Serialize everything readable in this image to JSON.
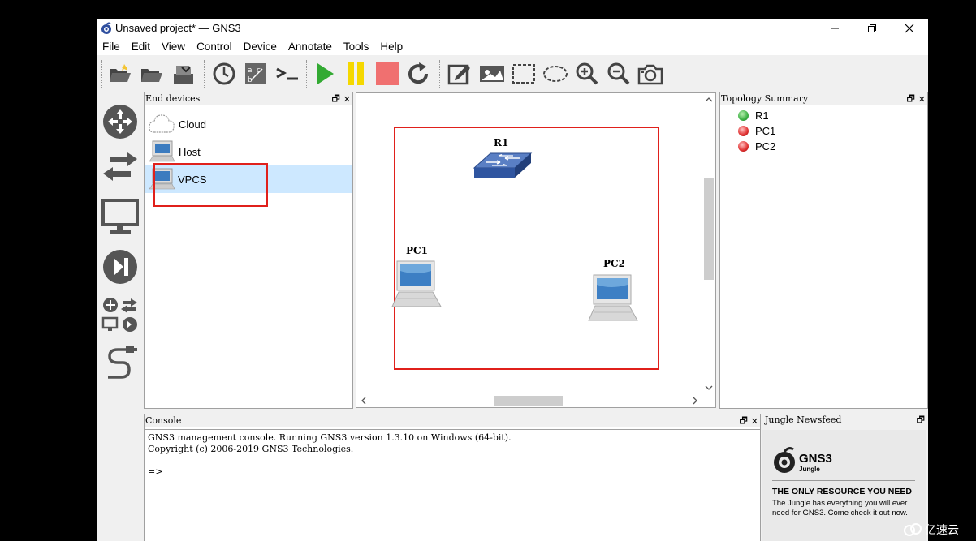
{
  "window": {
    "title": "Unsaved project* — GNS3",
    "controls": [
      "minimize",
      "restore",
      "close"
    ]
  },
  "menu": [
    "File",
    "Edit",
    "View",
    "Control",
    "Device",
    "Annotate",
    "Tools",
    "Help"
  ],
  "toolbar": {
    "buttons": [
      "new-project",
      "open-project",
      "save-project",
      "snapshot",
      "show-interface-labels",
      "console-all",
      "start-all",
      "suspend-all",
      "stop-all",
      "reload-all",
      "add-note",
      "insert-image",
      "draw-rectangle",
      "draw-ellipse",
      "zoom-in",
      "zoom-out",
      "screenshot"
    ]
  },
  "left_toolbar": [
    "routers",
    "switches",
    "end-devices",
    "security-devices",
    "all-devices",
    "add-link"
  ],
  "end_devices": {
    "title": "End devices",
    "items": [
      {
        "label": "Cloud"
      },
      {
        "label": "Host"
      },
      {
        "label": "VPCS"
      }
    ]
  },
  "topology": {
    "nodes": [
      {
        "label": "R1"
      },
      {
        "label": "PC1"
      },
      {
        "label": "PC2"
      }
    ]
  },
  "topology_summary": {
    "title": "Topology Summary",
    "items": [
      {
        "label": "R1",
        "status_color": "#3cb043"
      },
      {
        "label": "PC1",
        "status_color": "#e03030"
      },
      {
        "label": "PC2",
        "status_color": "#e03030"
      }
    ]
  },
  "console": {
    "title": "Console",
    "line1": "GNS3 management console. Running GNS3 version 1.3.10 on Windows (64-bit).",
    "line2": "Copyright (c) 2006-2019 GNS3 Technologies.",
    "prompt": "=>"
  },
  "newsfeed": {
    "title": "Jungle Newsfeed",
    "logo_text": "GNS3",
    "logo_sub": "Jungle",
    "headline": "THE ONLY RESOURCE YOU NEED",
    "body": "The Jungle has everything you will ever need for GNS3. Come check it out now."
  },
  "watermark": "亿速云",
  "colors": {
    "selection": "#cde8ff",
    "highlight_box": "#e0201b",
    "play": "#33aa33",
    "pause": "#f5d800",
    "stop": "#f07070"
  }
}
